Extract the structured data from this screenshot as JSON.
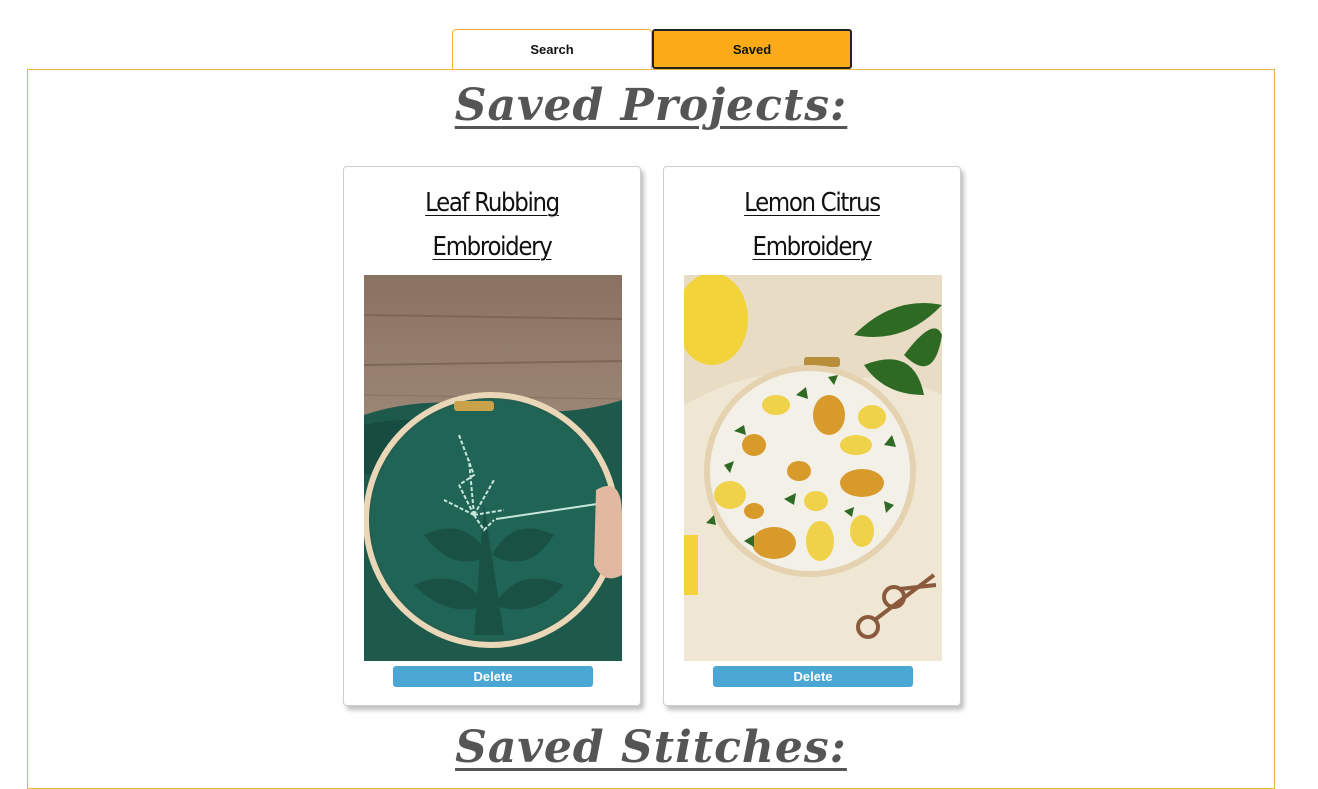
{
  "tabs": {
    "search_label": "Search",
    "saved_label": "Saved",
    "active": "Saved"
  },
  "saved_projects": {
    "heading": "Saved Projects:",
    "items": [
      {
        "title": "Leaf Rubbing Embroidery",
        "image_alt": "Green embroidery hoop with stitched leaf outline",
        "delete_label": "Delete"
      },
      {
        "title": "Lemon Citrus Embroidery",
        "image_alt": "Embroidery hoop with stitched lemons and leaves",
        "delete_label": "Delete"
      }
    ]
  },
  "saved_stitches": {
    "heading": "Saved Stitches:"
  },
  "colors": {
    "accent": "#fbab17",
    "panel_border": "#e8b83a",
    "button": "#4aa7d4"
  }
}
